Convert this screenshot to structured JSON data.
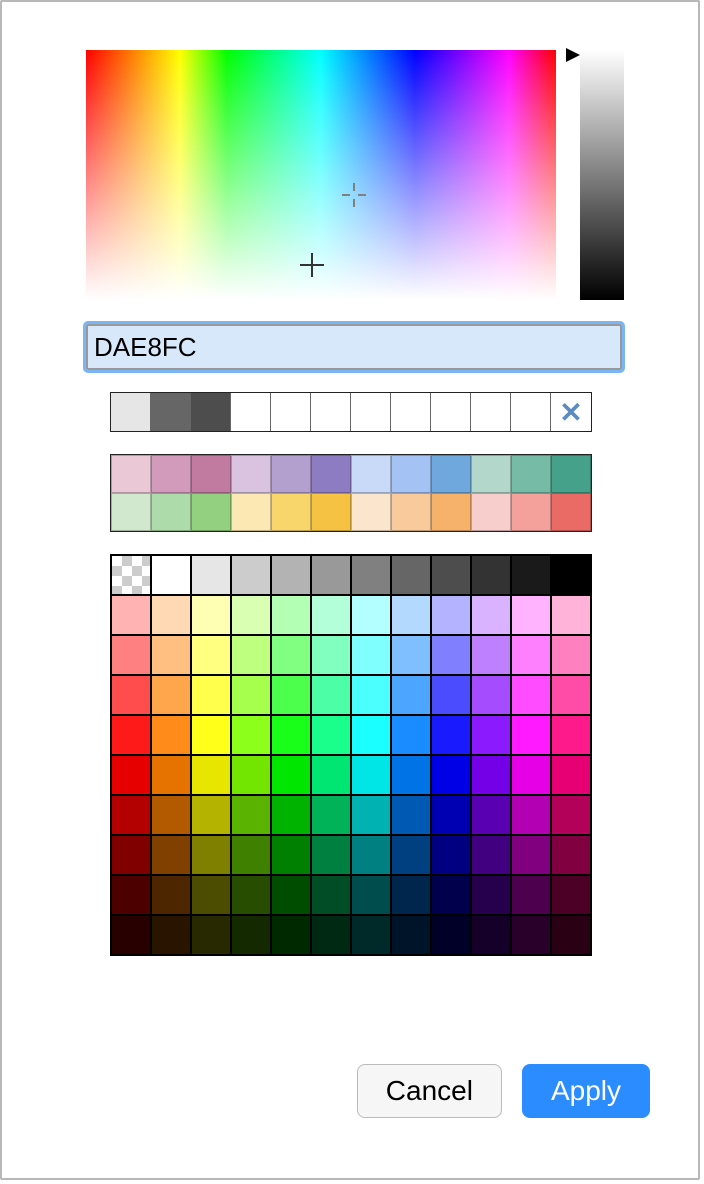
{
  "hex_value": "DAE8FC",
  "spectrum": {
    "selected_marker": {
      "x_pct": 57,
      "y_pct": 58
    },
    "hover_marker": {
      "x_pct": 48,
      "y_pct": 86
    }
  },
  "luminance_arrow_pct": 2,
  "recent_colors": [
    "#E6E6E6",
    "#666666",
    "#4D4D4D",
    "#FFFFFF",
    "#FFFFFF",
    "#FFFFFF",
    "#FFFFFF",
    "#FFFFFF",
    "#FFFFFF",
    "#FFFFFF",
    "#FFFFFF"
  ],
  "clear_recent_glyph": "✕",
  "preset_rows": [
    [
      "#EBC8D6",
      "#D39BBB",
      "#C27BA0",
      "#D9C3E0",
      "#B3A0CE",
      "#8E7CC3",
      "#C9DAF8",
      "#A4C2F4",
      "#6FA8DC",
      "#B4D7CC",
      "#76BBA6",
      "#45A189"
    ],
    [
      "#D2E8CE",
      "#ADDBAA",
      "#93D07F",
      "#FCE8B2",
      "#F9D66B",
      "#F6C244",
      "#FCE5CD",
      "#F9CB9C",
      "#F6B26B",
      "#F8CECC",
      "#F4A19C",
      "#EA6B66"
    ]
  ],
  "main_palette": {
    "cols": 12,
    "row_gray": [
      "transparent",
      "#FFFFFF",
      "#E6E6E6",
      "#CCCCCC",
      "#B3B3B3",
      "#999999",
      "#808080",
      "#666666",
      "#4D4D4D",
      "#333333",
      "#1A1A1A",
      "#000000"
    ],
    "hues": [
      0,
      30,
      60,
      90,
      120,
      150,
      180,
      210,
      240,
      270,
      300,
      330
    ],
    "light_rows": [
      85,
      75,
      65,
      55
    ],
    "dark_rows": [
      45,
      35,
      25,
      15,
      8
    ]
  },
  "buttons": {
    "cancel": "Cancel",
    "apply": "Apply"
  }
}
